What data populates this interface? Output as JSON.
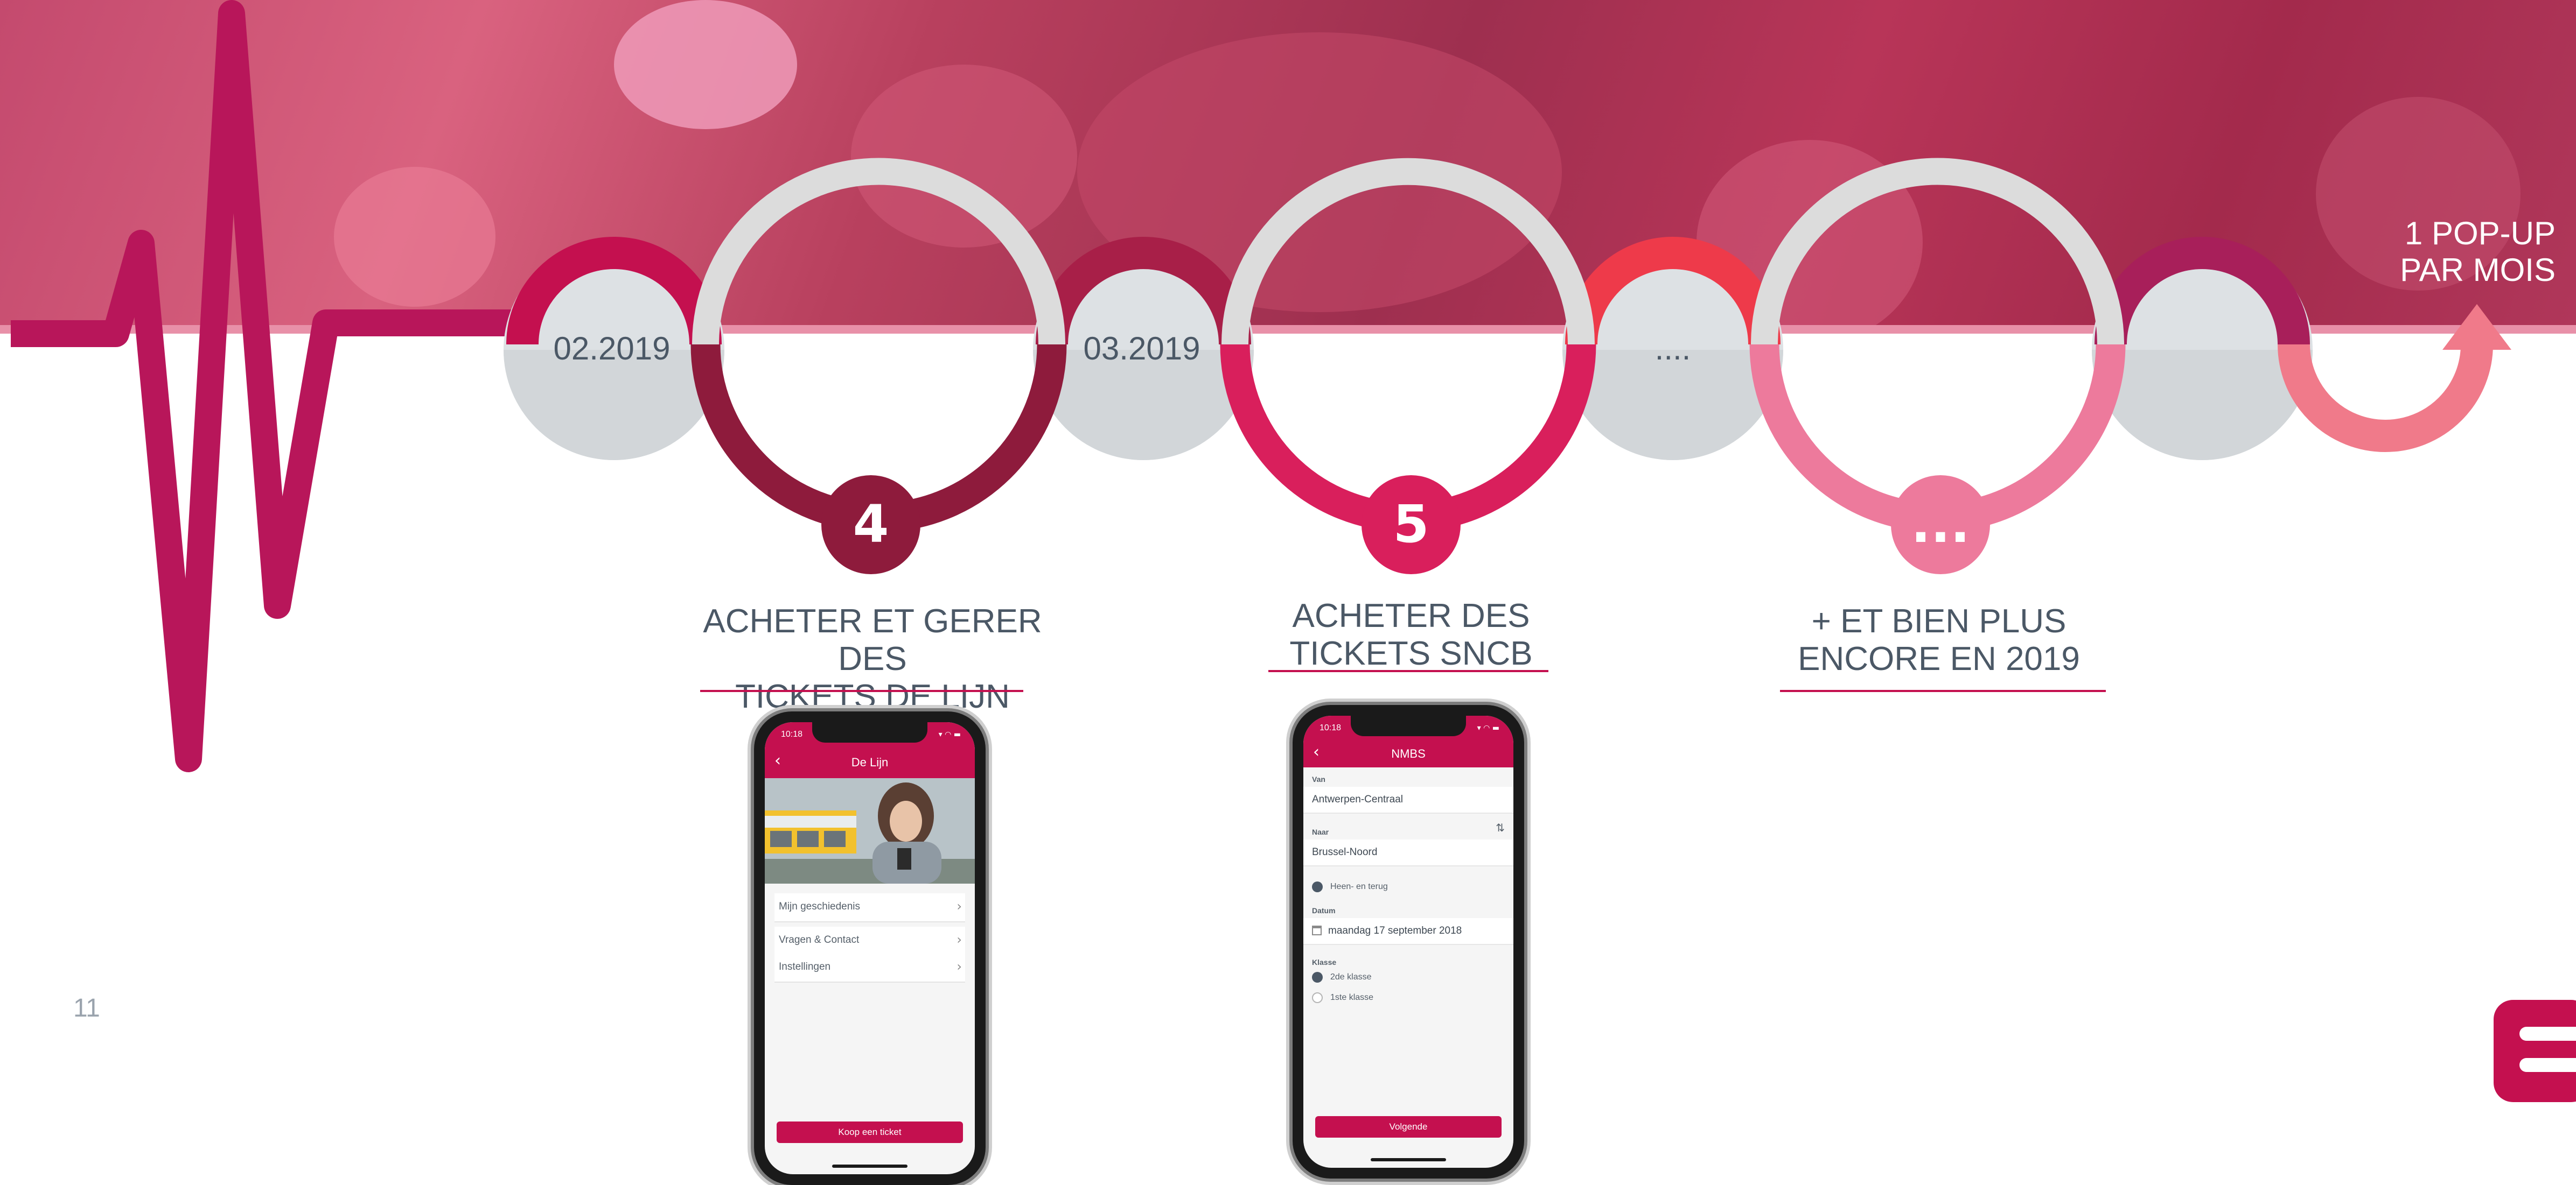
{
  "page_number": "11",
  "timeline": {
    "dates": [
      "02.2019",
      "03.2019",
      "...."
    ],
    "steps": [
      "4",
      "5",
      "..."
    ],
    "headings": [
      [
        "ACHETER ET GERER DES",
        "TICKETS DE LIJN"
      ],
      [
        "ACHETER DES",
        "TICKETS SNCB"
      ],
      [
        "+ ET BIEN PLUS",
        "ENCORE EN 2019"
      ]
    ],
    "popup_note": [
      "1 POP-UP",
      "PAR MOIS"
    ]
  },
  "colors": {
    "brand": "#c4104f",
    "dark_berry": "#8e1b3c",
    "raspberry": "#b01c4d",
    "pink": "#d91f5c",
    "light_pink": "#ed7a9c",
    "coral": "#f07a8a",
    "red": "#ee3a4a",
    "grey_ring": "#dcdcdc",
    "grey_disc": "#dde1e4",
    "text": "#4b5866"
  },
  "phone_delijn": {
    "status_time": "10:18",
    "status_icons": "▾ ◠ ▬",
    "back_icon": "chevron-left-icon",
    "title": "De Lijn",
    "menu": [
      "Mijn geschiedenis",
      "Vragen & Contact",
      "Instellingen"
    ],
    "cta": "Koop een ticket"
  },
  "phone_nmbs": {
    "status_time": "10:18",
    "status_icons": "▾ ◠ ▬",
    "back_icon": "chevron-left-icon",
    "title": "NMBS",
    "van_label": "Van",
    "van_value": "Antwerpen-Centraal",
    "naar_label": "Naar",
    "naar_value": "Brussel-Noord",
    "swap_icon": "swap-arrows-icon",
    "return_option": "Heen- en terug",
    "datum_label": "Datum",
    "datum_value": "maandag 17 september 2018",
    "calendar_icon": "calendar-icon",
    "klasse_label": "Klasse",
    "class_options": [
      "2de klasse",
      "1ste klasse"
    ],
    "cta": "Volgende"
  }
}
